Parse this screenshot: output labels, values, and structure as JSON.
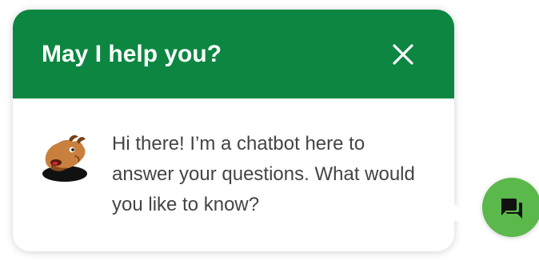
{
  "chat_widget": {
    "title": "May I help you?",
    "close_icon": "close-icon",
    "avatar_icon": "camel-mascot-avatar-icon",
    "message": "Hi there! I’m a chatbot here to answer your questions. What would you like to know?"
  },
  "launcher": {
    "icon": "chat-bubbles-icon"
  },
  "colors": {
    "header_bg": "#0c8641",
    "launcher_bg": "#5bb84a",
    "text": "#444444"
  }
}
